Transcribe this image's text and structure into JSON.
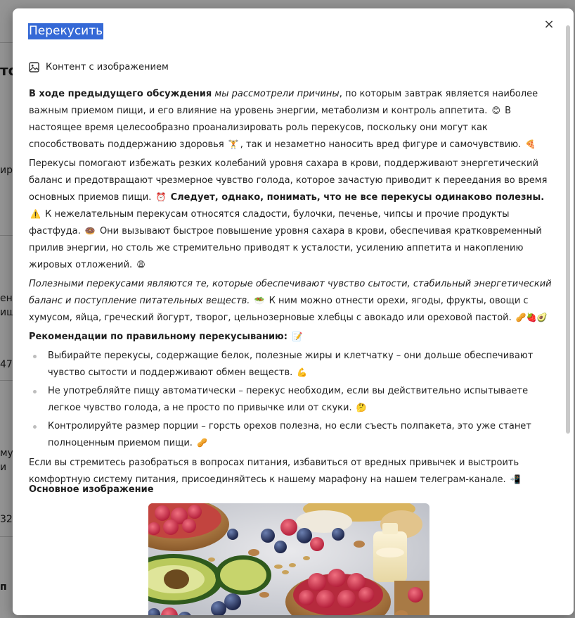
{
  "modal": {
    "title": "Перекусить",
    "close_icon": "×",
    "content_type_icon": "image-icon",
    "content_type_label": "Контент с изображением"
  },
  "article": {
    "p1": {
      "lead_bold": "В ходе предыдущего обсуждения",
      "lead_italic": "мы рассмотрели причины",
      "text": ", по которым завтрак является наиболее важным приемом пищи, и его влияние на уровень энергии, метаболизм и контроль аппетита.",
      "emoji1": "😊",
      "text2": "В настоящее время целесообразно проанализировать роль перекусов, поскольку они могут как способствовать поддержанию здоровья",
      "emoji2": "🏋",
      "text3": ", так и незаметно наносить вред фигуре и самочувствию.",
      "emoji3": "🍕"
    },
    "p2": {
      "text": "Перекусы помогают избежать резких колебаний уровня сахара в крови, поддерживают энергетический баланс и предотвращают чрезмерное чувство голода, которое зачастую приводит к переедания во время основных приемов пищи.",
      "emoji1": "⏰",
      "bold": "Следует, однако, понимать, что не все перекусы одинаково полезны.",
      "emoji2": "⚠️",
      "text2": "К нежелательным перекусам относятся сладости, булочки, печенье, чипсы и прочие продукты фастфуда.",
      "emoji3": "🍩",
      "text3": "Они вызывают быстрое повышение уровня сахара в крови, обеспечивая кратковременный прилив энергии, но столь же стремительно приводят к усталости, усилению аппетита и накоплению жировых отложений.",
      "emoji4": "😩"
    },
    "p3": {
      "italic": "Полезными перекусами являются те, которые обеспечивают чувство сытости, стабильный энергетический баланс и поступление питательных веществ.",
      "emoji1": "🥗",
      "text": "К ним можно отнести орехи, ягоды, фрукты, овощи с хумусом, яйца, греческий йогурт, творог, цельнозерновые хлебцы с авокадо или ореховой пастой.",
      "emoji2": "🥜🍓🥑"
    },
    "recommendations": {
      "title": "Рекомендации по правильному перекусыванию:",
      "emoji": "📝",
      "items": [
        {
          "text": "Выбирайте перекусы, содержащие белок, полезные жиры и клетчатку – они дольше обеспечивают чувство сытости и поддерживают обмен веществ.",
          "emoji": "💪"
        },
        {
          "text": "Не употребляйте пищу автоматически – перекус необходим, если вы действительно испытываете легкое чувство голода, а не просто по привычке или от скуки.",
          "emoji": "🤔"
        },
        {
          "text": "Контролируйте размер порции – горсть орехов полезна, но если съесть полпакета, это уже станет полноценным приемом пищи.",
          "emoji": "🥜"
        }
      ]
    },
    "p4": {
      "text": "Если вы стремитесь разобраться в вопросах питания, избавиться от вредных привычек и выстроить комфортную систему питания, присоединяйтесь к нашему марафону на нашем телеграм-канале.",
      "emoji": "📲"
    }
  },
  "image_section": {
    "heading": "Основное изображение"
  },
  "background_fragments": [
    "то",
    "ир",
    "ен",
    "иш",
    "47",
    "му",
    "и",
    "32",
    "п"
  ],
  "colors": {
    "title_highlight": "#3569d6",
    "overlay": "rgba(0,0,0,0.42)",
    "bullet": "#bdbdbd"
  }
}
